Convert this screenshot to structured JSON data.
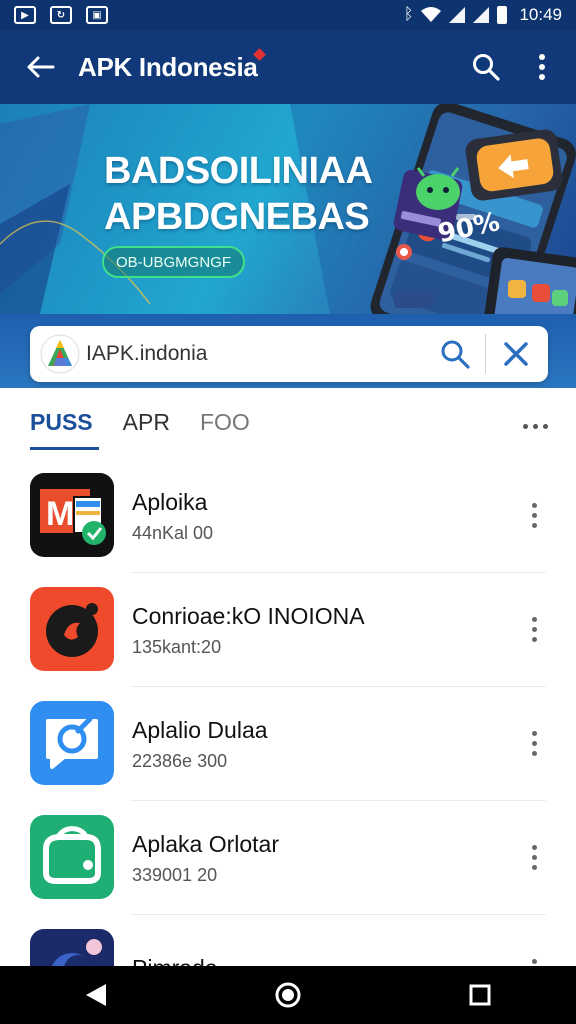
{
  "status_bar": {
    "time": "10:49"
  },
  "app_bar": {
    "title": "APK Indonesia"
  },
  "banner": {
    "headline_line1": "BADSOILINIAA",
    "headline_line2": "APBDGNEBAS",
    "pill_label": "OB-UBGMGNGF",
    "percent": "90%"
  },
  "search": {
    "value": "IAPK.indonia",
    "placeholder": ""
  },
  "tabs": [
    {
      "label": "PUSS",
      "active": true
    },
    {
      "label": "APR",
      "active": false
    },
    {
      "label": "FOO",
      "active": false
    }
  ],
  "apps": [
    {
      "name": "Aploika",
      "subtitle": "44nKal 00",
      "icon": "multi-window-app-icon",
      "color": "#111111"
    },
    {
      "name": "Conrioae:kO INOIONA",
      "subtitle": "135kant:20",
      "icon": "record-app-icon",
      "color": "#ef4a2c"
    },
    {
      "name": "Aplalio Dulaa",
      "subtitle": "22386e 300",
      "icon": "chat-check-app-icon",
      "color": "#2f8ef0"
    },
    {
      "name": "Aplaka Orlotar",
      "subtitle": "339001 20",
      "icon": "wallet-app-icon",
      "color": "#1fae74"
    },
    {
      "name": "Pimrada",
      "subtitle": "",
      "icon": "dark-app-icon",
      "color": "#1b2a68"
    }
  ]
}
